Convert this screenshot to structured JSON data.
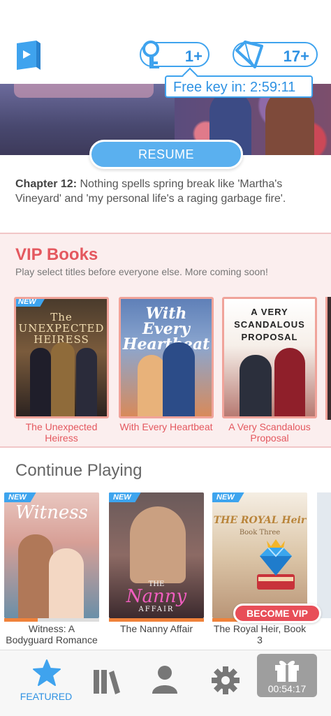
{
  "header": {
    "keys_count": "1+",
    "gems_count": "17+",
    "tooltip": "Free key in: 2:59:11"
  },
  "hero": {
    "resume_label": "RESUME",
    "chapter_label": "Chapter 12:",
    "chapter_text": " Nothing spells spring break like 'Martha's Vineyard' and 'my personal life's a raging garbage fire'."
  },
  "vip": {
    "title": "VIP Books",
    "subtitle": "Play select titles before everyone else. More coming soon!",
    "books": [
      {
        "title": "The Unexpected Heiress",
        "cover_text": "The UNEXPECTED HEIRESS",
        "badge": "NEW"
      },
      {
        "title": "With Every Heartbeat",
        "cover_text": "With Every Heartbeat"
      },
      {
        "title": "A Very Scandalous Proposal",
        "cover_text": "A VERY SCANDALOUS PROPOSAL"
      }
    ]
  },
  "continue": {
    "title": "Continue Playing",
    "books": [
      {
        "title": "Witness: A Bodyguard Romance",
        "cover_text": "Witness",
        "badge": "NEW",
        "progress": 0.35
      },
      {
        "title": "The Nanny Affair",
        "cover_text": "Nanny",
        "cover_small": "THE",
        "cover_small2": "AFFAIR",
        "badge": "NEW",
        "progress": 1.0
      },
      {
        "title": "The Royal Heir, Book 3",
        "cover_text": "THE ROYAL Heir",
        "cover_small": "Book Three",
        "badge": "NEW",
        "progress": 0.5
      }
    ],
    "become_vip": "BECOME VIP"
  },
  "nav": {
    "featured": "FEATURED",
    "timer": "00:54:17"
  },
  "colors": {
    "accent": "#3fa3ee",
    "vip_red": "#e4585f",
    "progress_orange": "#f0823a"
  }
}
